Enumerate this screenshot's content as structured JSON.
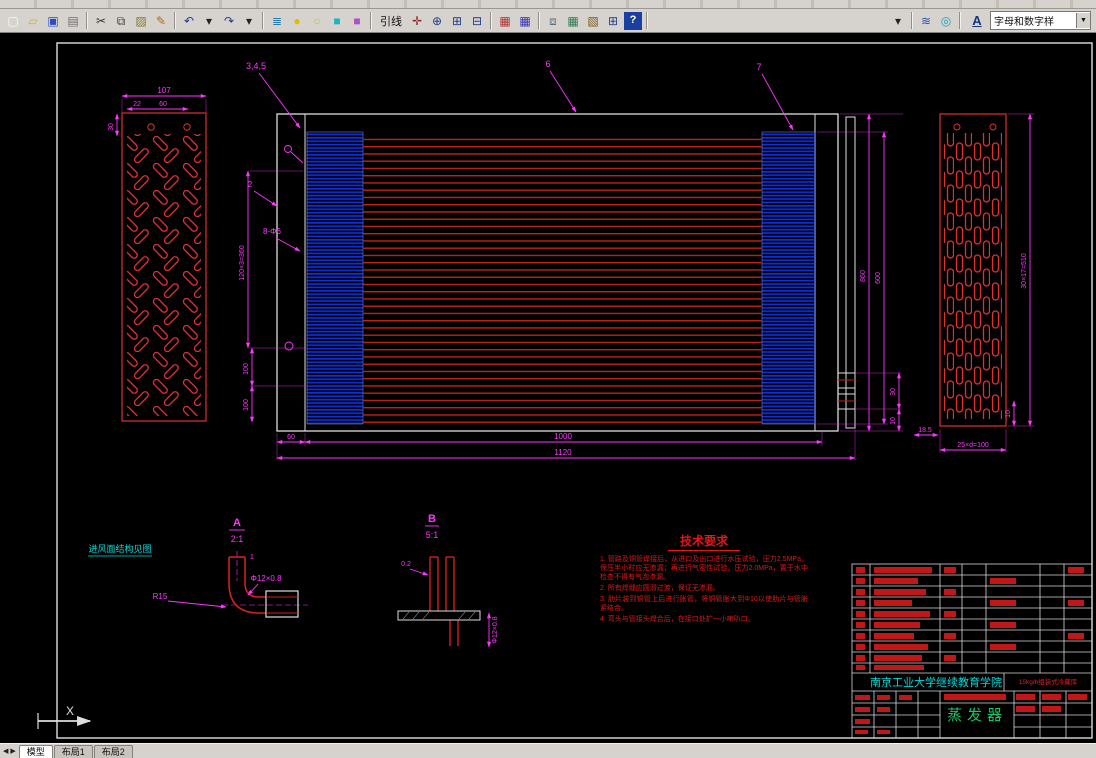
{
  "toolbar": {
    "groups_left": [
      {
        "items": [
          {
            "n": "new-file-icon",
            "g": "▢",
            "c": "#f8f8f8"
          },
          {
            "n": "open-file-icon",
            "g": "▱",
            "c": "#d8ae28"
          },
          {
            "n": "save-icon",
            "g": "▣",
            "c": "#2d49c8"
          },
          {
            "n": "print-icon",
            "g": "▤",
            "c": "#707070"
          }
        ]
      },
      {
        "items": [
          {
            "n": "cut-icon",
            "g": "✂",
            "c": "#333333"
          },
          {
            "n": "copy-icon",
            "g": "⧉",
            "c": "#444444"
          },
          {
            "n": "paste-icon",
            "g": "▨",
            "c": "#8a7a30"
          },
          {
            "n": "match-properties-icon",
            "g": "✎",
            "c": "#b06a10"
          }
        ]
      },
      {
        "items": [
          {
            "n": "undo-icon",
            "g": "↶",
            "c": "#223a8c"
          },
          {
            "n": "undo-dropdown-icon",
            "g": "▾",
            "c": "#222222"
          },
          {
            "n": "redo-icon",
            "g": "↷",
            "c": "#223a8c"
          },
          {
            "n": "redo-dropdown-icon",
            "g": "▾",
            "c": "#222222"
          }
        ]
      },
      {
        "items": [
          {
            "n": "layers-icon",
            "g": "≣",
            "c": "#2878b0"
          },
          {
            "n": "layer-on-bulb-icon",
            "g": "●",
            "c": "#e0bc00"
          },
          {
            "n": "layer-off-bulb-icon",
            "g": "○",
            "c": "#e0bc00"
          },
          {
            "n": "color-chip-cyan-icon",
            "g": "■",
            "c": "#18b8b8"
          },
          {
            "n": "color-chip-magenta-icon",
            "g": "■",
            "c": "#b050c0"
          }
        ]
      }
    ],
    "leader_label": "引线",
    "groups_mid": [
      {
        "items": [
          {
            "n": "pan-icon",
            "g": "✛",
            "c": "#8a2020"
          },
          {
            "n": "zoom-realtime-icon",
            "g": "⊕",
            "c": "#1c3c8c"
          },
          {
            "n": "zoom-window-icon",
            "g": "⊞",
            "c": "#1c3c8c"
          },
          {
            "n": "zoom-previous-icon",
            "g": "⊟",
            "c": "#1c3c8c"
          }
        ]
      },
      {
        "items": [
          {
            "n": "properties-icon",
            "g": "▦",
            "c": "#b03030"
          },
          {
            "n": "design-center-icon",
            "g": "▦",
            "c": "#3030b0"
          }
        ]
      },
      {
        "items": [
          {
            "n": "sheet-set-icon",
            "g": "⧈",
            "c": "#607080"
          },
          {
            "n": "table-icon",
            "g": "▦",
            "c": "#2a7a50"
          },
          {
            "n": "render-icon",
            "g": "▧",
            "c": "#7a5a20"
          },
          {
            "n": "calculator-icon",
            "g": "⊞",
            "c": "#28418c"
          },
          {
            "n": "help-icon",
            "g": "?",
            "c": "#ffffff",
            "bg": "#1b3fa0"
          }
        ]
      }
    ],
    "groups_right": [
      {
        "items": [
          {
            "n": "toolbar-overflow-icon",
            "g": "▾",
            "c": "#222222"
          }
        ]
      },
      {
        "items": [
          {
            "n": "layer-states-icon",
            "g": "≋",
            "c": "#2850b8"
          },
          {
            "n": "orbit-icon",
            "g": "◎",
            "c": "#18a0c0"
          }
        ]
      }
    ],
    "style_icon": "A",
    "style_combo_value": "字母和数字样"
  },
  "statusbar": {
    "tabs": [
      "模型",
      "布局1",
      "布局2"
    ]
  },
  "drawing": {
    "callouts": {
      "c345": "3,4,5",
      "c6": "6",
      "c7": "7",
      "c2": "2",
      "holes": "8-Φ6"
    },
    "left_plate": {
      "w": "107",
      "a": "22",
      "b": "60",
      "h": "30"
    },
    "main_dims": {
      "rows": "120×3=360",
      "s1": "100",
      "s2": "100",
      "b60": "60",
      "b1000": "1000",
      "b1120": "1120",
      "r860": "860",
      "r600": "600",
      "r30": "30",
      "r10": "10",
      "r185": "18.5"
    },
    "right_plate": {
      "v": "30×17=510",
      "bottom": "25×d=100",
      "d10": "10"
    },
    "detail_a": {
      "label": "A",
      "scale": "2:1",
      "dim": "Φ12×0.8",
      "radius": "R15",
      "num": "1",
      "note": "进风面结构见图"
    },
    "detail_b": {
      "label": "B",
      "scale": "5:1",
      "dim": "Φ12×0.8",
      "gap": "0.2"
    },
    "tech": {
      "title": "技术要求",
      "items": [
        "1. 管路及铜管焊接后，从进口及出口进行水压试验，压力2.5MPa，保压半小时应无渗漏；再进行气密性试验，压力2.0MPa，置于水中检查不得有气泡渗漏。",
        "2. 所有焊缝应圆滑过渡，保证无渗漏。",
        "3. 肋片装到铜管上后进行胀管，将铜管胀大到Φ10以使肋片与管胀紧结合。",
        "4. 弯头与管接头焊合后，在接口处扩一小喇叭口。"
      ]
    },
    "title_block": {
      "school": "南京工业大学继续教育学院",
      "product": "15kg/h组装式冷藏库",
      "part": "蒸发器"
    },
    "ucs_x": "X"
  }
}
